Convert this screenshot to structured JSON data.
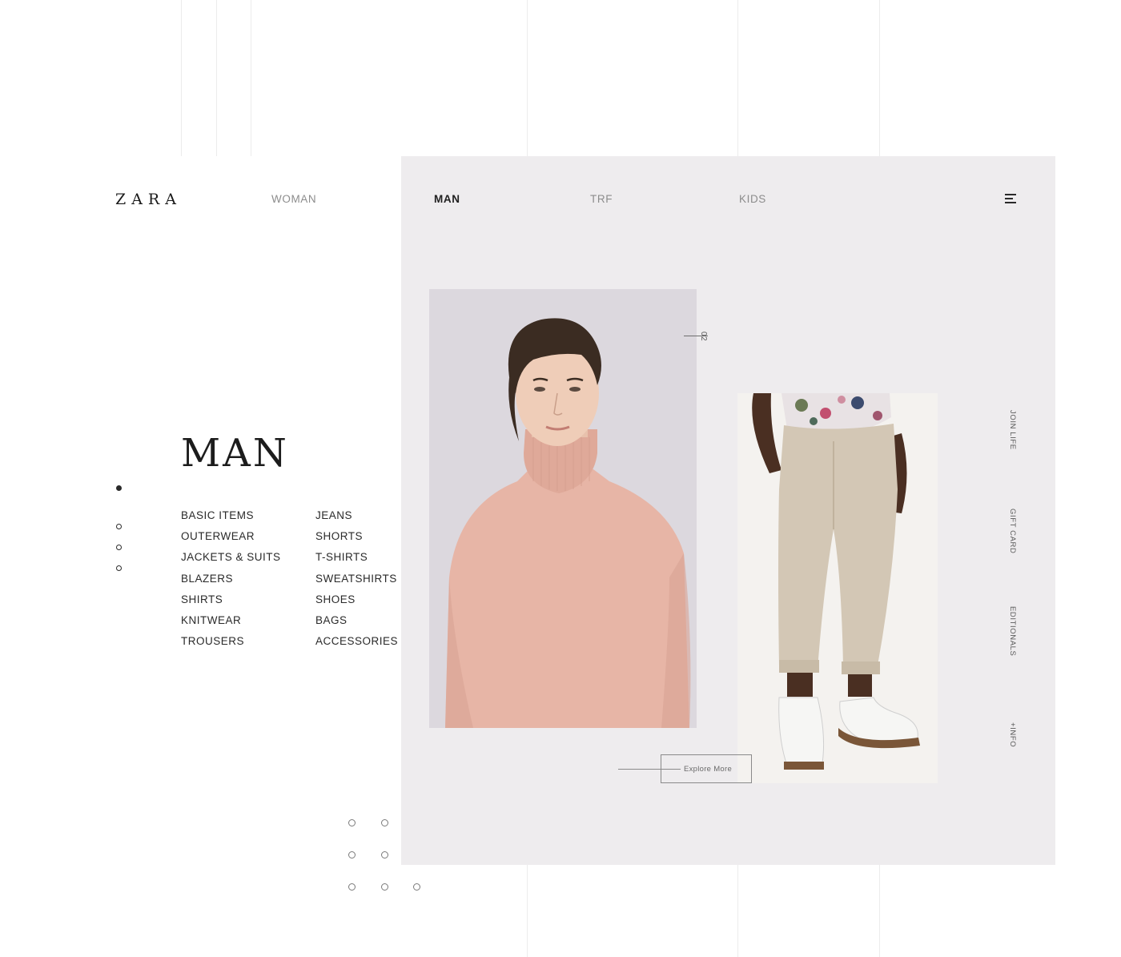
{
  "brand": {
    "logo_text": "ZARA"
  },
  "nav": {
    "items": [
      {
        "label": "WOMAN",
        "active": false
      },
      {
        "label": "MAN",
        "active": true
      },
      {
        "label": "TRF",
        "active": false
      },
      {
        "label": "KIDS",
        "active": false
      }
    ],
    "menu_icon": "hamburger-menu-icon"
  },
  "hero": {
    "title": "MAN"
  },
  "categories": {
    "left": [
      "BASIC ITEMS",
      "OUTERWEAR",
      "JACKETS & SUITS",
      "BLAZERS",
      "SHIRTS",
      "KNITWEAR",
      "TROUSERS"
    ],
    "right": [
      "JEANS",
      "SHORTS",
      "T-SHIRTS",
      "SWEATSHIRTS",
      "SHOES",
      "BAGS",
      "ACCESSORIES"
    ]
  },
  "slider": {
    "total": 4,
    "active_index": 0
  },
  "gallery": {
    "index_label": "02",
    "explore_label": "Explore More",
    "photo1": "man-in-pink-turtleneck-sweater-photo",
    "photo2": "beige-chino-trousers-white-sneakers-photo"
  },
  "side_links": [
    "JOIN LIFE",
    "GIFT CARD",
    "EDITIONALS",
    "+INFO"
  ],
  "colors": {
    "panel_bg": "#eeecee",
    "text_dark": "#1f1f1f",
    "text_muted": "#8c8c8c",
    "sweater": "#e7b5a6",
    "trousers": "#d3c7b5"
  }
}
